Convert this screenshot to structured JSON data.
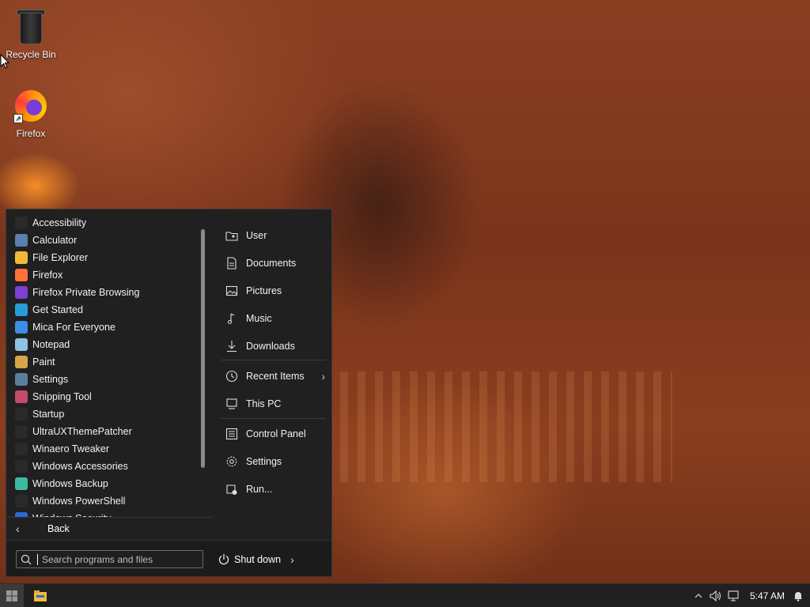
{
  "desktop": {
    "icons": [
      {
        "label": "Recycle Bin",
        "icon": "recycle-bin-icon"
      },
      {
        "label": "Firefox",
        "icon": "firefox-icon"
      }
    ]
  },
  "start_menu": {
    "apps": [
      {
        "label": "Accessibility",
        "icon": "folder-icon",
        "color": "#2a2a2a"
      },
      {
        "label": "Calculator",
        "icon": "calculator-icon",
        "color": "#5b7fb0"
      },
      {
        "label": "File Explorer",
        "icon": "file-explorer-icon",
        "color": "#f0b93a"
      },
      {
        "label": "Firefox",
        "icon": "firefox-icon",
        "color": "#ff7139"
      },
      {
        "label": "Firefox Private Browsing",
        "icon": "firefox-private-icon",
        "color": "#7d3fd6"
      },
      {
        "label": "Get Started",
        "icon": "get-started-icon",
        "color": "#2a9ad8"
      },
      {
        "label": "Mica For Everyone",
        "icon": "mica-icon",
        "color": "#3a8ee6"
      },
      {
        "label": "Notepad",
        "icon": "notepad-icon",
        "color": "#8ec3e6"
      },
      {
        "label": "Paint",
        "icon": "paint-icon",
        "color": "#d8a34a"
      },
      {
        "label": "Settings",
        "icon": "settings-icon",
        "color": "#5d7d9e"
      },
      {
        "label": "Snipping Tool",
        "icon": "snipping-tool-icon",
        "color": "#c44a6c"
      },
      {
        "label": "Startup",
        "icon": "folder-icon",
        "color": "#2a2a2a"
      },
      {
        "label": "UltraUXThemePatcher",
        "icon": "folder-icon",
        "color": "#2a2a2a"
      },
      {
        "label": "Winaero Tweaker",
        "icon": "folder-icon",
        "color": "#2a2a2a"
      },
      {
        "label": "Windows Accessories",
        "icon": "folder-icon",
        "color": "#2a2a2a"
      },
      {
        "label": "Windows Backup",
        "icon": "backup-icon",
        "color": "#3cb9a0"
      },
      {
        "label": "Windows PowerShell",
        "icon": "folder-icon",
        "color": "#2a2a2a"
      },
      {
        "label": "Windows Security",
        "icon": "security-icon",
        "color": "#2a6ad8"
      }
    ],
    "back_label": "Back",
    "places": [
      {
        "label": "User",
        "icon": "user-folder-icon"
      },
      {
        "label": "Documents",
        "icon": "documents-icon"
      },
      {
        "label": "Pictures",
        "icon": "pictures-icon"
      },
      {
        "label": "Music",
        "icon": "music-icon"
      },
      {
        "label": "Downloads",
        "icon": "downloads-icon"
      },
      {
        "label": "Recent Items",
        "icon": "recent-items-icon"
      },
      {
        "label": "This PC",
        "icon": "this-pc-icon"
      },
      {
        "label": "Control Panel",
        "icon": "control-panel-icon"
      },
      {
        "label": "Settings",
        "icon": "settings-icon"
      },
      {
        "label": "Run...",
        "icon": "run-icon"
      }
    ],
    "search_placeholder": "Search programs and files",
    "shutdown_label": "Shut down"
  },
  "taskbar": {
    "clock": "5:47 AM"
  }
}
